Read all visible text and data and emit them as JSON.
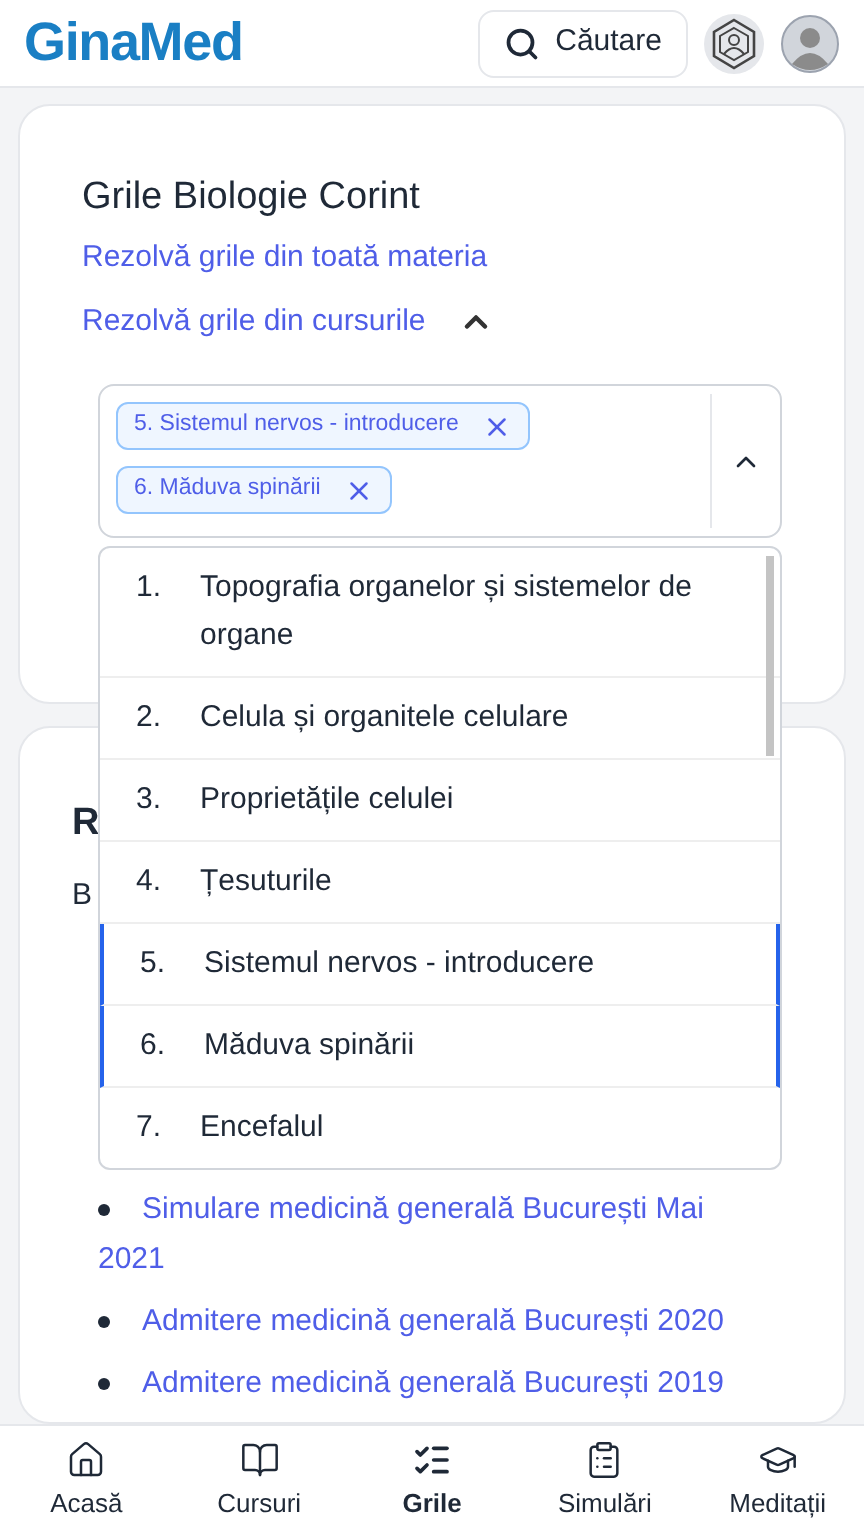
{
  "header": {
    "logo": "GinaMed",
    "search_label": "Căutare"
  },
  "card": {
    "title": "Grile Biologie Corint",
    "links": [
      {
        "label": "Rezolvă grile din toată materia"
      },
      {
        "label": "Rezolvă grile din cursurile",
        "expanded": true
      }
    ]
  },
  "select": {
    "chips": [
      "5. Sistemul nervos - introducere",
      "6. Măduva spinării"
    ],
    "open": true
  },
  "options": [
    {
      "number": "1.",
      "label": "Topografia organelor și sistemelor de organe",
      "selected": false
    },
    {
      "number": "2.",
      "label": "Celula și organitele celulare",
      "selected": false
    },
    {
      "number": "3.",
      "label": "Proprietățile celulei",
      "selected": false
    },
    {
      "number": "4.",
      "label": "Țesuturile",
      "selected": false
    },
    {
      "number": "5.",
      "label": "Sistemul nervos - introducere",
      "selected": true
    },
    {
      "number": "6.",
      "label": "Măduva spinării",
      "selected": true
    },
    {
      "number": "7.",
      "label": "Encefalul",
      "selected": false
    }
  ],
  "card2": {
    "heading": "R",
    "text": "B",
    "links": [
      "Simulare medicină generală București Mai 2021",
      "Admitere medicină generală București 2020",
      "Admitere medicină generală București 2019"
    ]
  },
  "nav": [
    {
      "label": "Acasă",
      "selected": false
    },
    {
      "label": "Cursuri",
      "selected": false
    },
    {
      "label": "Grile",
      "selected": true
    },
    {
      "label": "Simulări",
      "selected": false
    },
    {
      "label": "Meditații",
      "selected": false
    }
  ]
}
